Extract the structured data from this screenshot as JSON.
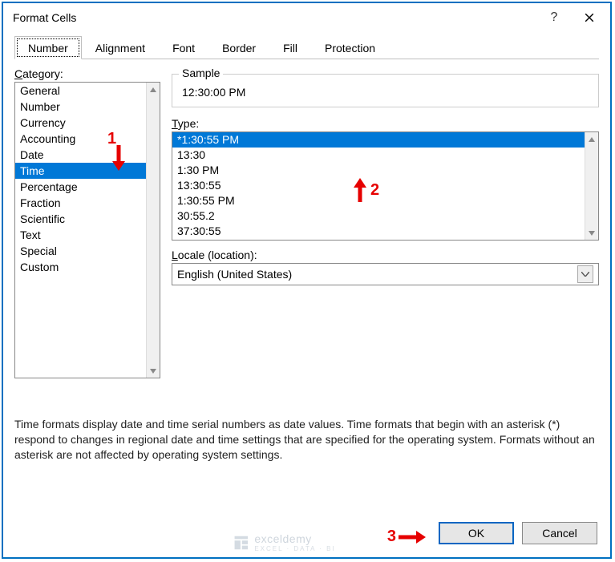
{
  "window": {
    "title": "Format Cells",
    "help_icon": "?",
    "close_icon": "✕"
  },
  "tabs": [
    {
      "label": "Number",
      "active": true
    },
    {
      "label": "Alignment",
      "active": false
    },
    {
      "label": "Font",
      "active": false
    },
    {
      "label": "Border",
      "active": false
    },
    {
      "label": "Fill",
      "active": false
    },
    {
      "label": "Protection",
      "active": false
    }
  ],
  "category": {
    "label_pre": "C",
    "label_post": "ategory:",
    "items": [
      "General",
      "Number",
      "Currency",
      "Accounting",
      "Date",
      "Time",
      "Percentage",
      "Fraction",
      "Scientific",
      "Text",
      "Special",
      "Custom"
    ],
    "selected": "Time"
  },
  "sample": {
    "label": "Sample",
    "value": "12:30:00 PM"
  },
  "type": {
    "label_pre": "T",
    "label_post": "ype:",
    "items": [
      "*1:30:55 PM",
      "13:30",
      "1:30 PM",
      "13:30:55",
      "1:30:55 PM",
      "30:55.2",
      "37:30:55"
    ],
    "selected": "*1:30:55 PM"
  },
  "locale": {
    "label_pre": "L",
    "label_post": "ocale (location):",
    "value": "English (United States)"
  },
  "description": "Time formats display date and time serial numbers as date values.  Time formats that begin with an asterisk (*) respond to changes in regional date and time settings that are specified for the operating system. Formats without an asterisk are not affected by operating system settings.",
  "buttons": {
    "ok": "OK",
    "cancel": "Cancel"
  },
  "watermark": {
    "brand": "exceldemy",
    "sub": "EXCEL · DATA · BI"
  },
  "annotations": {
    "a1": "1",
    "a2": "2",
    "a3": "3"
  }
}
